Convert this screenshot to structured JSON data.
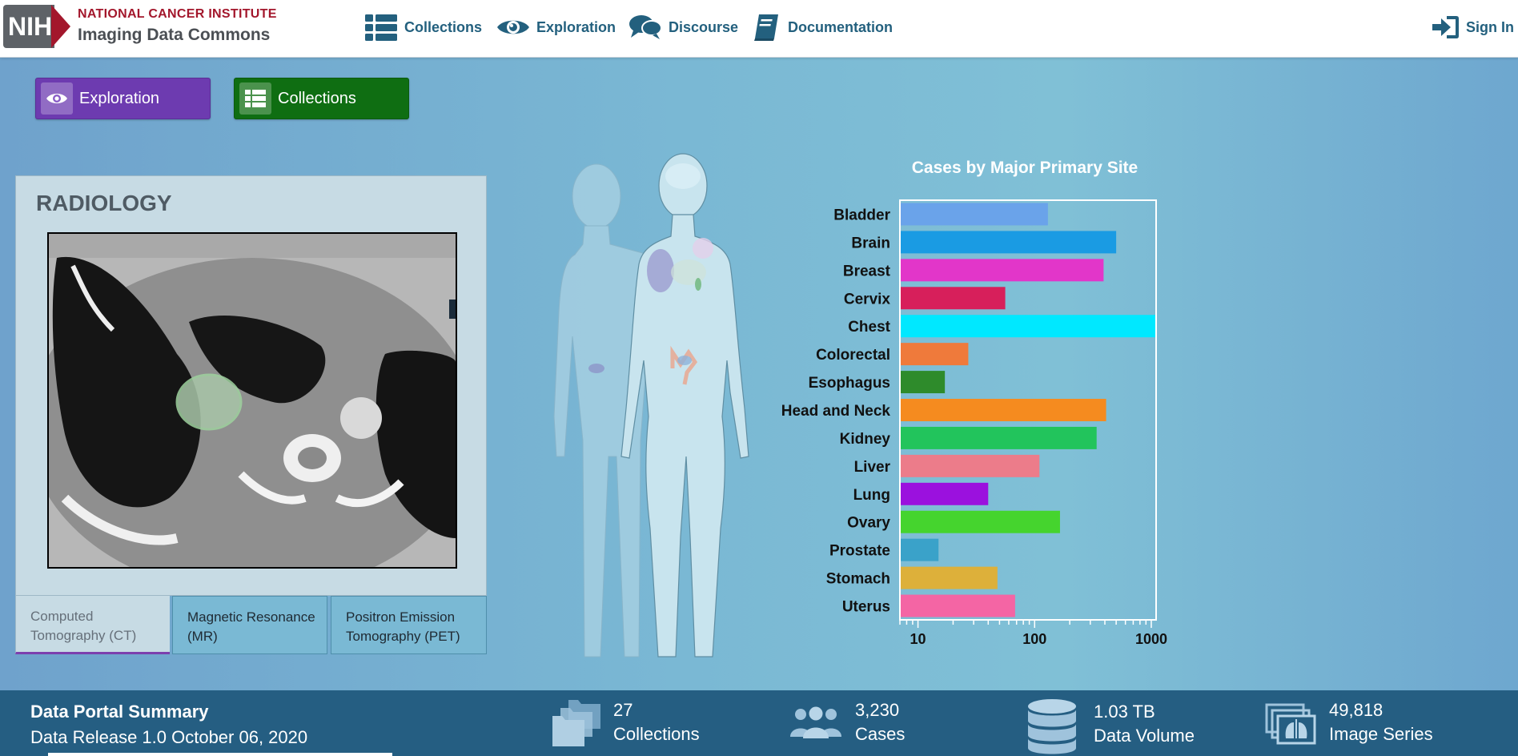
{
  "header": {
    "logo_badge": "NIH",
    "org_name": "NATIONAL CANCER INSTITUTE",
    "product_name": "Imaging Data Commons",
    "nav": [
      {
        "label": "Collections",
        "icon": "table-list-icon"
      },
      {
        "label": "Exploration",
        "icon": "eye-icon"
      },
      {
        "label": "Discourse",
        "icon": "chat-bubbles-icon"
      },
      {
        "label": "Documentation",
        "icon": "book-icon"
      }
    ],
    "sign_in": "Sign In"
  },
  "mode_buttons": {
    "exploration": "Exploration",
    "collections": "Collections"
  },
  "radiology": {
    "title": "RADIOLOGY",
    "tabs": [
      "Computed Tomography (CT)",
      "Magnetic Resonance (MR)",
      "Positron Emission Tomography (PET)"
    ],
    "active_tab": 0
  },
  "chart_data": {
    "type": "bar",
    "orientation": "horizontal",
    "title": "Cases by Major Primary Site",
    "xscale": "log",
    "xlim": [
      7,
      1100
    ],
    "xticks": [
      "10",
      "100",
      "1000"
    ],
    "categories": [
      "Bladder",
      "Brain",
      "Breast",
      "Cervix",
      "Chest",
      "Colorectal",
      "Esophagus",
      "Head and Neck",
      "Kidney",
      "Liver",
      "Lung",
      "Ovary",
      "Prostate",
      "Stomach",
      "Uterus"
    ],
    "values": [
      130,
      500,
      390,
      56,
      1100,
      27,
      17,
      410,
      340,
      110,
      40,
      165,
      15,
      48,
      68
    ],
    "colors": [
      "#6aa3ea",
      "#1a9be3",
      "#e236c9",
      "#d71f5b",
      "#00e8ff",
      "#ef7a3b",
      "#2e8b2b",
      "#f58b1f",
      "#22c45c",
      "#ec7c8a",
      "#9b11de",
      "#45d42e",
      "#3aa2c9",
      "#ddb03a",
      "#f465a4"
    ]
  },
  "footer": {
    "title": "Data Portal Summary",
    "release": "Data Release 1.0 October 06, 2020",
    "stats": [
      {
        "value": "27",
        "label": "Collections",
        "icon": "folders-icon"
      },
      {
        "value": "3,230",
        "label": "Cases",
        "icon": "people-icon"
      },
      {
        "value": "1.03 TB",
        "label": "Data Volume",
        "icon": "database-icon"
      },
      {
        "value": "49,818",
        "label": "Image Series",
        "icon": "image-series-icon"
      }
    ]
  }
}
